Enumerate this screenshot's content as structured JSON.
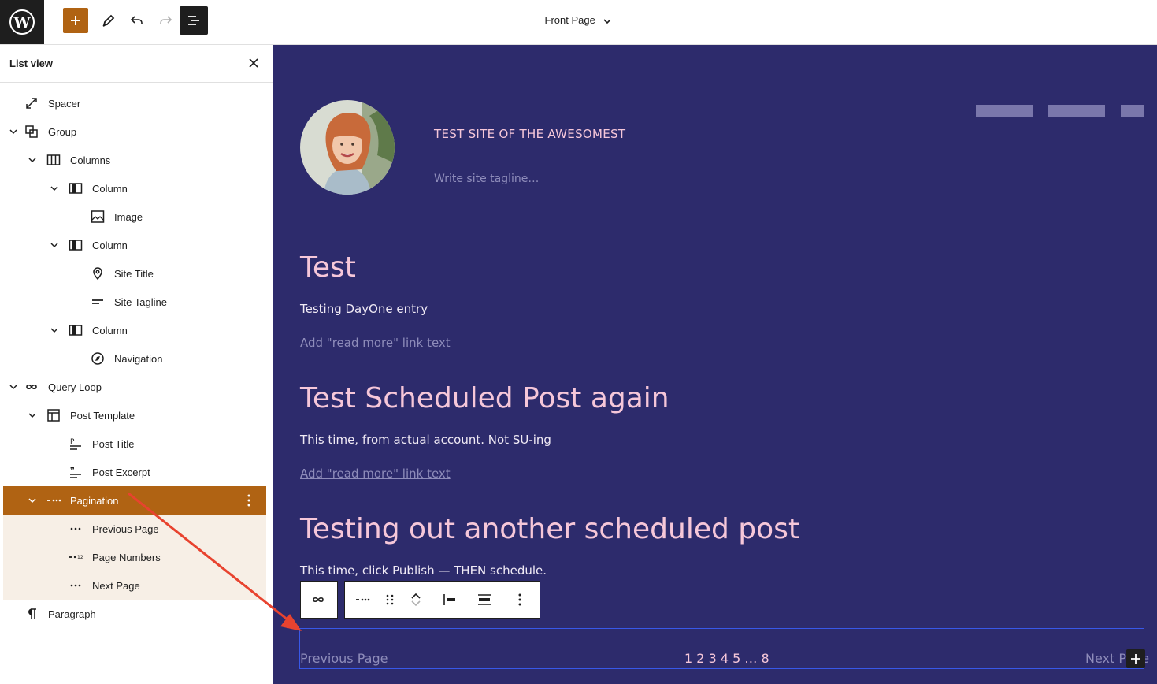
{
  "topbar": {
    "document_title": "Front Page"
  },
  "sidebar": {
    "title": "List view",
    "items": [
      {
        "label": "Spacer"
      },
      {
        "label": "Group"
      },
      {
        "label": "Columns"
      },
      {
        "label": "Column"
      },
      {
        "label": "Image"
      },
      {
        "label": "Column"
      },
      {
        "label": "Site Title"
      },
      {
        "label": "Site Tagline"
      },
      {
        "label": "Column"
      },
      {
        "label": "Navigation"
      },
      {
        "label": "Query Loop"
      },
      {
        "label": "Post Template"
      },
      {
        "label": "Post Title"
      },
      {
        "label": "Post Excerpt"
      },
      {
        "label": "Pagination"
      },
      {
        "label": "Previous Page"
      },
      {
        "label": "Page Numbers"
      },
      {
        "label": "Next Page"
      },
      {
        "label": "Paragraph"
      }
    ]
  },
  "canvas": {
    "site_title": "TEST SITE OF THE AWESOMEST",
    "tagline_placeholder": "Write site tagline…",
    "posts": [
      {
        "title": "Test",
        "excerpt": "Testing DayOne entry",
        "read_more": "Add \"read more\" link text"
      },
      {
        "title": "Test Scheduled Post again",
        "excerpt": "This time, from actual account. Not SU-ing",
        "read_more": "Add \"read more\" link text"
      },
      {
        "title": "Testing out another scheduled post",
        "excerpt": "This time, click Publish — THEN schedule.",
        "read_more": "Add \"read more\" link text"
      }
    ],
    "pagination": {
      "previous": "Previous Page",
      "numbers": [
        "1",
        "2",
        "3",
        "4",
        "5",
        "…",
        "8"
      ],
      "next": "Next Page"
    }
  },
  "colors": {
    "accent": "#b06313",
    "canvas_bg": "#2d2b6c",
    "heading": "#f6c7d9",
    "selection_outline": "#3858e9",
    "annotation_arrow": "#e8432f"
  }
}
